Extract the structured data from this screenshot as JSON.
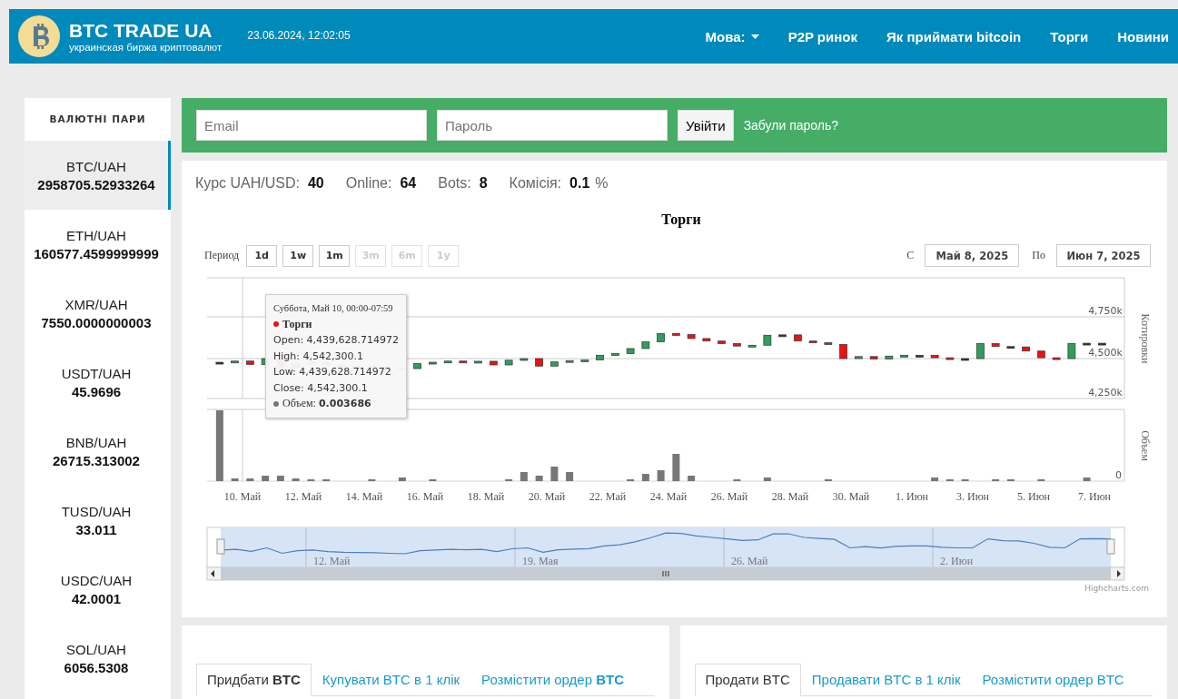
{
  "header": {
    "logo_title": "BTC TRADE UA",
    "logo_subtitle": "украинская биржа криптовалют",
    "datetime": "23.06.2024, 12:02:05",
    "nav": [
      {
        "label": "Мова:",
        "dropdown": true
      },
      {
        "label": "P2P ринок",
        "dropdown": false
      },
      {
        "label": "Як приймати bitcoin",
        "dropdown": false
      },
      {
        "label": "Торги",
        "dropdown": false
      },
      {
        "label": "Новини",
        "dropdown": false
      }
    ]
  },
  "sidebar": {
    "title": "ВАЛЮТНІ ПАРИ",
    "items": [
      {
        "pair": "BTC/UAH",
        "rate": "2958705.52933264",
        "selected": true
      },
      {
        "pair": "ETH/UAH",
        "rate": "160577.4599999999",
        "selected": false
      },
      {
        "pair": "XMR/UAH",
        "rate": "7550.0000000003",
        "selected": false
      },
      {
        "pair": "USDT/UAH",
        "rate": "45.9696",
        "selected": false
      },
      {
        "pair": "BNB/UAH",
        "rate": "26715.313002",
        "selected": false
      },
      {
        "pair": "TUSD/UAH",
        "rate": "33.011",
        "selected": false
      },
      {
        "pair": "USDC/UAH",
        "rate": "42.0001",
        "selected": false
      },
      {
        "pair": "SOL/UAH",
        "rate": "6056.5308",
        "selected": false
      }
    ]
  },
  "login": {
    "email_placeholder": "Email",
    "password_placeholder": "Пароль",
    "submit": "Увійти",
    "forgot": "Забули пароль?"
  },
  "stats": [
    {
      "label": "Курс UAH/USD:",
      "value": "40"
    },
    {
      "label": "Online:",
      "value": "64"
    },
    {
      "label": "Bots:",
      "value": "8"
    },
    {
      "label": "Комісія:",
      "value": "0.1",
      "unit": "%"
    }
  ],
  "chart": {
    "title": "Торги",
    "period_label": "Период",
    "periods": [
      {
        "label": "1d",
        "disabled": false
      },
      {
        "label": "1w",
        "disabled": false
      },
      {
        "label": "1m",
        "disabled": false
      },
      {
        "label": "3m",
        "disabled": true
      },
      {
        "label": "6m",
        "disabled": true
      },
      {
        "label": "1y",
        "disabled": true
      }
    ],
    "from_label": "С",
    "from": "Май 8, 2025",
    "to_label": "По",
    "to": "Июн 7, 2025",
    "y_axis_title": "Котировки",
    "y_axis_labels": [
      "4,750k",
      "4,500k",
      "4,250k"
    ],
    "x_axis_labels": [
      "10. Май",
      "12. Май",
      "14. Май",
      "16. Май",
      "18. Май",
      "20. Май",
      "22. Май",
      "24. Май",
      "26. Май",
      "28. Май",
      "30. Май",
      "1. Июн",
      "3. Июн",
      "5. Июн",
      "7. Июн"
    ],
    "volume_label": "Объем",
    "volume_tick": "0",
    "navigator_labels": [
      "12. Май",
      "19. Мая",
      "26. Май",
      "2. Июн"
    ],
    "credit": "Highcharts.com",
    "tooltip": {
      "title": "Суббота, Май 10, 00:00-07:59",
      "series": "Торги",
      "rows": [
        "Open: 4,439,628.714972",
        "High: 4,542,300.1",
        "Low: 4,439,628.714972",
        "Close: 4,542,300.1"
      ],
      "volume_label": "Объем:",
      "volume": "0.003686"
    }
  },
  "buy_tabs": [
    {
      "label": "Придбати **BTC**",
      "selected": true
    },
    {
      "label": "Купувати BTC в 1 клік",
      "selected": false
    },
    {
      "label": "Розмістити ордер **BTC**",
      "selected": false
    }
  ],
  "sell_tabs": [
    {
      "label": "Продати BTC",
      "selected": true
    },
    {
      "label": "Продавати BTC в 1 клік",
      "selected": false
    },
    {
      "label": "Розмістити ордер BTC",
      "selected": false
    }
  ]
}
